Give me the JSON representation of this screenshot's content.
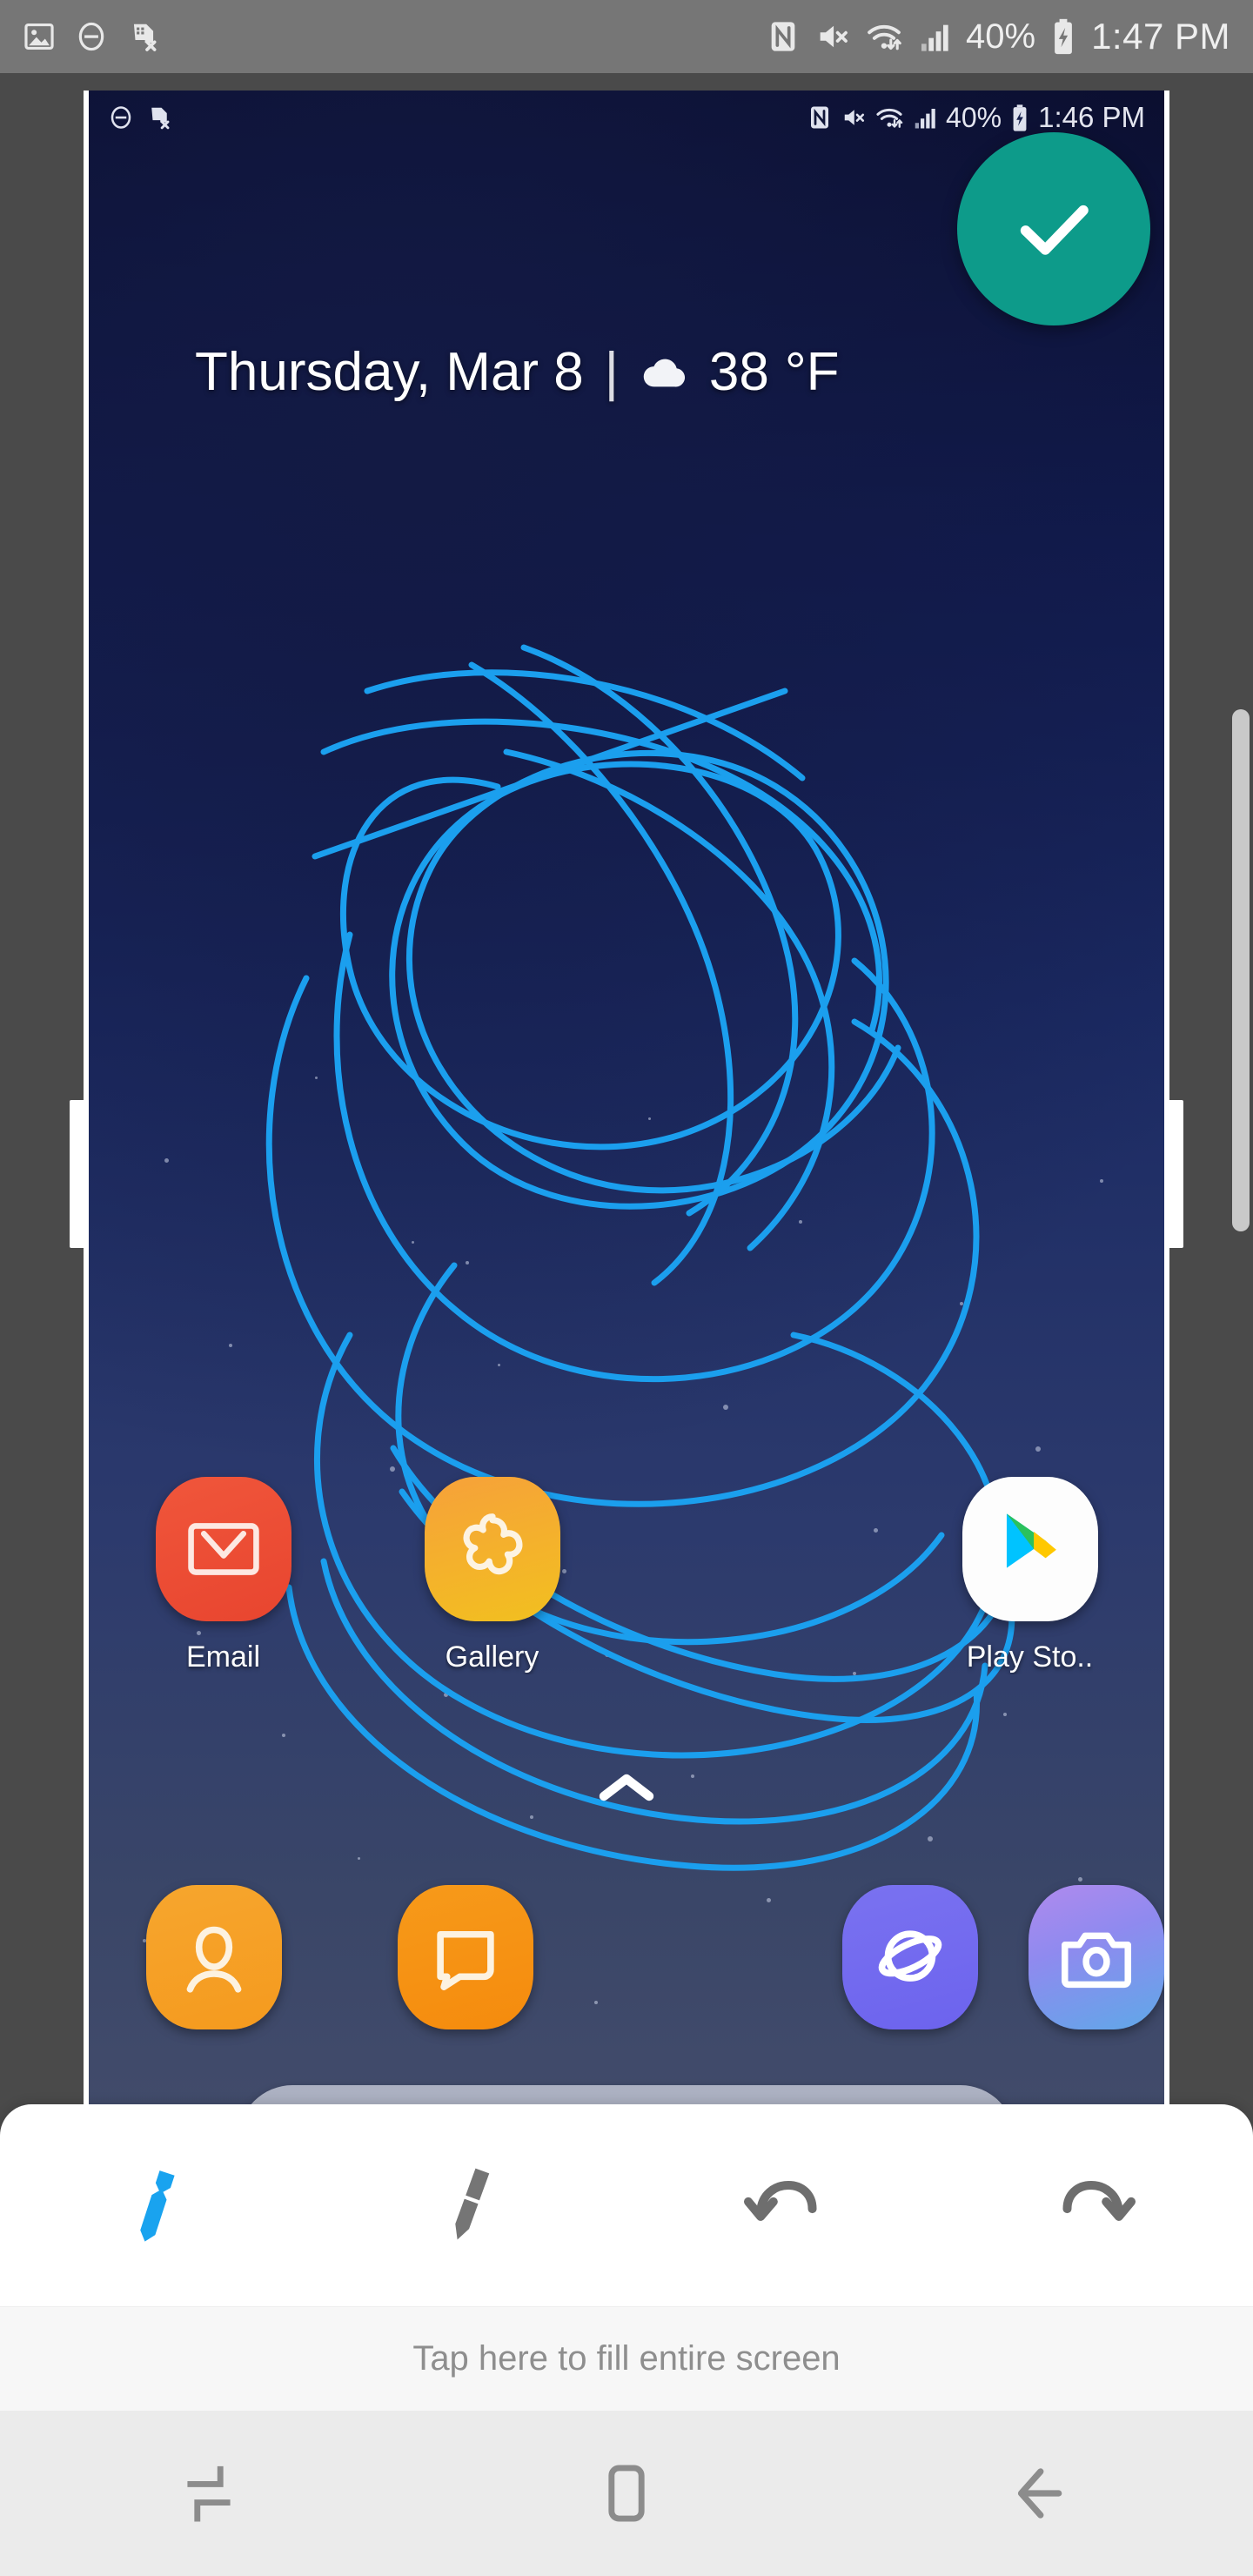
{
  "os_status_bar": {
    "icons_left": [
      "image-icon",
      "do-not-disturb-icon",
      "sim-card-error-icon"
    ],
    "icons_right": [
      "nfc-icon",
      "mute-icon",
      "wifi-icon",
      "signal-icon",
      "battery-charging-icon"
    ],
    "battery_percent": "40%",
    "time": "1:47 PM"
  },
  "captured_status_bar": {
    "icons_left": [
      "do-not-disturb-icon",
      "sim-card-error-icon"
    ],
    "icons_right": [
      "nfc-icon",
      "mute-icon",
      "wifi-icon",
      "signal-icon",
      "battery-charging-icon"
    ],
    "battery_percent": "40%",
    "time": "1:46 PM"
  },
  "home_screen": {
    "date": "Thursday, Mar 8",
    "separator": "|",
    "weather_icon": "cloud-icon",
    "temperature": "38",
    "temperature_unit": "°F",
    "apps": [
      {
        "label": "Email",
        "icon": "email-icon"
      },
      {
        "label": "Gallery",
        "icon": "gallery-icon"
      },
      {
        "label": "",
        "icon": "empty-slot"
      },
      {
        "label": "Play Sto..",
        "icon": "play-store-icon"
      }
    ],
    "drawer_indicator_icon": "chevron-up-icon",
    "dock": [
      {
        "label": "Contacts",
        "icon": "contacts-icon"
      },
      {
        "label": "Messages",
        "icon": "messages-icon"
      },
      {
        "label": "",
        "icon": "empty-slot"
      },
      {
        "label": "Internet",
        "icon": "internet-icon"
      },
      {
        "label": "Camera",
        "icon": "camera-icon"
      }
    ],
    "search_bar": {
      "logo": "google-g-icon",
      "value": "",
      "placeholder": ""
    }
  },
  "editor": {
    "confirm_button": {
      "icon": "check-icon",
      "color": "#0d9b8a"
    },
    "tools": [
      {
        "name": "pen",
        "icon": "pen-icon",
        "active": true,
        "color": "#19a3ef"
      },
      {
        "name": "highlighter",
        "icon": "marker-icon",
        "active": false,
        "color": "#757575"
      },
      {
        "name": "undo",
        "icon": "undo-icon",
        "active": false,
        "color": "#6e6e6e"
      },
      {
        "name": "redo",
        "icon": "redo-icon",
        "active": false,
        "color": "#6e6e6e"
      }
    ],
    "fill_hint": "Tap here to fill entire screen",
    "scroll_indicator": true,
    "annotation_color": "#1b9fee"
  },
  "nav_bar": {
    "buttons": [
      {
        "name": "recents",
        "icon": "recents-icon"
      },
      {
        "name": "home",
        "icon": "home-icon"
      },
      {
        "name": "back",
        "icon": "back-arrow-icon"
      }
    ]
  },
  "colors": {
    "status_bar_bg": "#767676",
    "page_bg": "#4a4a4a",
    "accent_teal": "#0d9b8a",
    "accent_blue": "#19a3ef"
  }
}
